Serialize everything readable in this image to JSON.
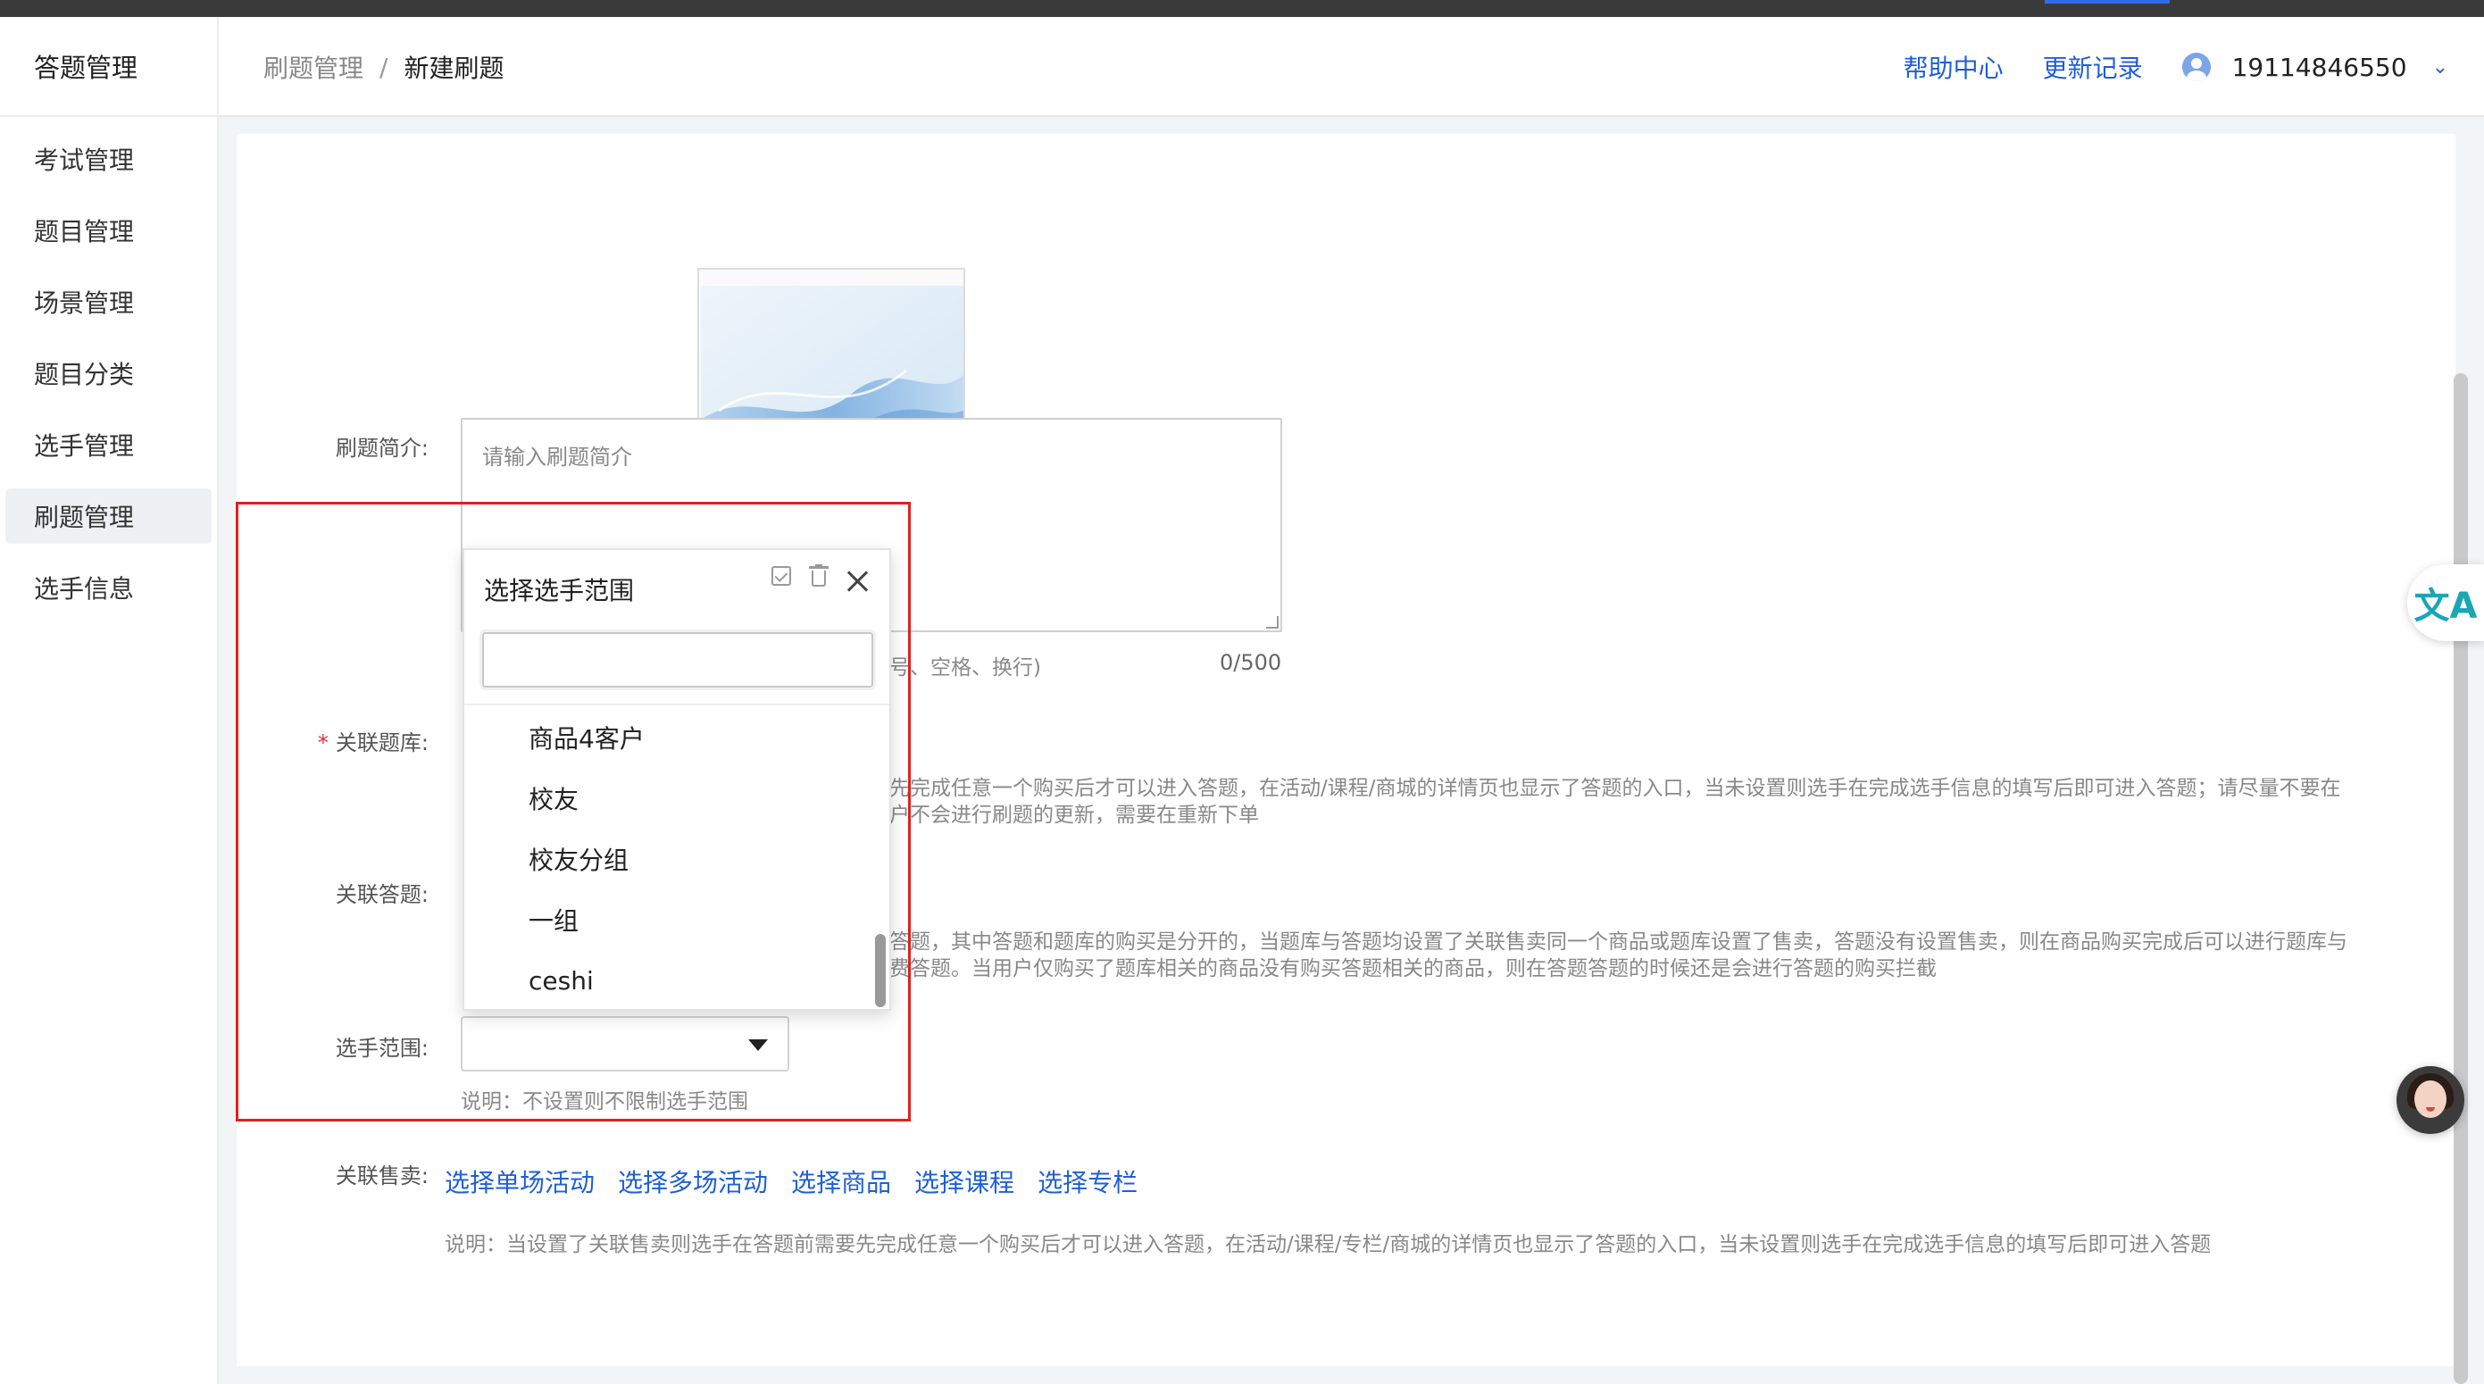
{
  "sidebar": {
    "brand": "答题管理",
    "items": [
      {
        "label": "考试管理"
      },
      {
        "label": "题目管理"
      },
      {
        "label": "场景管理"
      },
      {
        "label": "题目分类"
      },
      {
        "label": "选手管理"
      },
      {
        "label": "刷题管理",
        "active": true
      },
      {
        "label": "选手信息"
      }
    ]
  },
  "header": {
    "breadcrumb": [
      "刷题管理",
      "新建刷题"
    ],
    "separator": "/",
    "links": [
      "帮助中心",
      "更新记录"
    ],
    "user_phone": "19114846550",
    "dropdown_icon": "chevron-down-icon"
  },
  "form": {
    "intro": {
      "label": "刷题简介:",
      "placeholder": "请输入刷题简介",
      "hint_visible": "号、空格、换行)",
      "counter": "0/500"
    },
    "bank": {
      "required_mark": "*",
      "label": "关联题库:",
      "desc_line1": "先完成任意一个购买后才可以进入答题，在活动/课程/商城的详情页也显示了答题的入口，当未设置则选手在完成选手信息的填写后即可进入答题；请尽量不要在",
      "desc_line2": "户不会进行刷题的更新，需要在重新下单"
    },
    "quiz": {
      "label": "关联答题:",
      "desc_line1": "答题，其中答题和题库的购买是分开的，当题库与答题均设置了关联售卖同一个商品或题库设置了售卖，答题没有设置售卖，则在商品购买完成后可以进行题库与",
      "desc_line2": "费答题。当用户仅购买了题库相关的商品没有购买答题相关的商品，则在答题答题的时候还是会进行答题的购买拦截"
    },
    "scope": {
      "label": "选手范围:",
      "value": "",
      "note": "说明：不设置则不限制选手范围"
    },
    "sales": {
      "label": "关联售卖:",
      "links": [
        "选择单场活动",
        "选择多场活动",
        "选择商品",
        "选择课程",
        "选择专栏"
      ],
      "note": "说明：当设置了关联售卖则选手在答题前需要先完成任意一个购买后才可以进入答题，在活动/课程/专栏/商城的详情页也显示了答题的入口，当未设置则选手在完成选手信息的填写后即可进入答题"
    }
  },
  "dropdown": {
    "title": "选择选手范围",
    "search_value": "",
    "options": [
      "商品4客户",
      "校友",
      "校友分组",
      "一组",
      "ceshi"
    ]
  },
  "widgets": {
    "translate_glyph": "文A"
  },
  "colors": {
    "accent": "#1f5fd6",
    "highlight_border": "#e02020",
    "required": "#e0302f"
  }
}
